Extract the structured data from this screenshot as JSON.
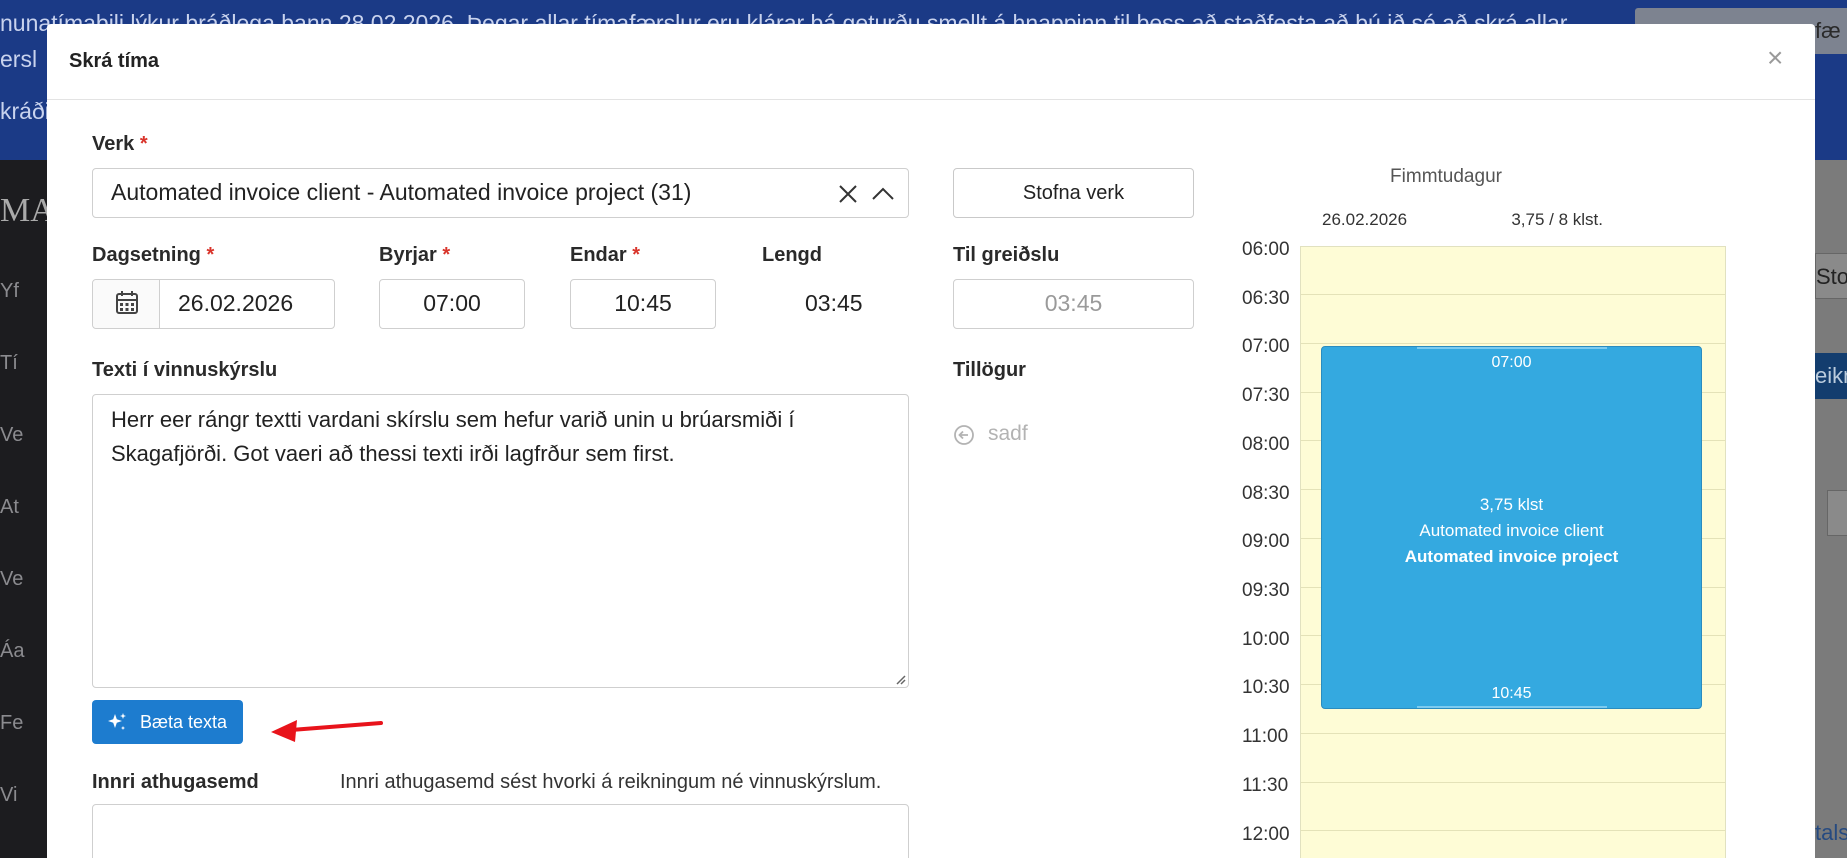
{
  "background": {
    "banner_line1": "nunatímabili lýkur bráðlega þann 28.02.2026. Þegar allar tímafærslur eru klárar þá geturðu smellt á hnappinn til þess að staðfesta að þú ið sé að skrá allar",
    "banner_line2": "ersl",
    "banner_line3": "kráði",
    "banner_button": "fæ",
    "logo": "MA",
    "sidebar_items": [
      "Yf",
      "Tí",
      "Ve",
      "At",
      "Ve",
      "Áa",
      "Fe",
      "Vi"
    ],
    "right_button_1": "Sto",
    "right_button_2": "eikn",
    "right_link": "tals"
  },
  "modal": {
    "title": "Skrá tíma",
    "close": "×",
    "verk": {
      "label": "Verk",
      "required": "*",
      "value": "Automated invoice client - Automated invoice project (31)"
    },
    "create_button": "Stofna verk",
    "date": {
      "label": "Dagsetning",
      "required": "*",
      "value": "26.02.2026"
    },
    "start": {
      "label": "Byrjar",
      "required": "*",
      "value": "07:00"
    },
    "end": {
      "label": "Endar",
      "required": "*",
      "value": "10:45"
    },
    "length": {
      "label": "Lengd",
      "value": "03:45"
    },
    "billable": {
      "label": "Til greiðslu",
      "value": "03:45"
    },
    "report_text": {
      "label": "Texti í vinnuskýrslu",
      "line1": "Herr eer rángr textti vardani skírslu sem hefur varið unin u brúarsmiði í",
      "line2": "Skagafjörði. Got vaeri að thessi texti irði lagfrður sem first."
    },
    "improve_button": "Bæta texta",
    "suggestions": {
      "label": "Tillögur",
      "items": [
        "sadf"
      ]
    },
    "internal_note": {
      "label": "Innri athugasemd",
      "hint": "Innri athugasemd sést hvorki á reikningum né vinnuskýrslum."
    }
  },
  "calendar": {
    "weekday": "Fimmtudagur",
    "date": "26.02.2026",
    "hours_summary": "3,75 / 8 klst.",
    "time_labels": [
      "06:00",
      "06:30",
      "07:00",
      "07:30",
      "08:00",
      "08:30",
      "09:00",
      "09:30",
      "10:00",
      "10:30",
      "11:00",
      "11:30",
      "12:00"
    ],
    "event": {
      "start": "07:00",
      "end": "10:45",
      "duration": "3,75 klst",
      "client": "Automated invoice client",
      "project": "Automated invoice project"
    }
  },
  "colors": {
    "primary": "#1d7ccf",
    "event": "#34a9e0",
    "calendar_bg": "#fefcd6",
    "required": "#d9342b",
    "annotation_arrow": "#e8141b"
  }
}
